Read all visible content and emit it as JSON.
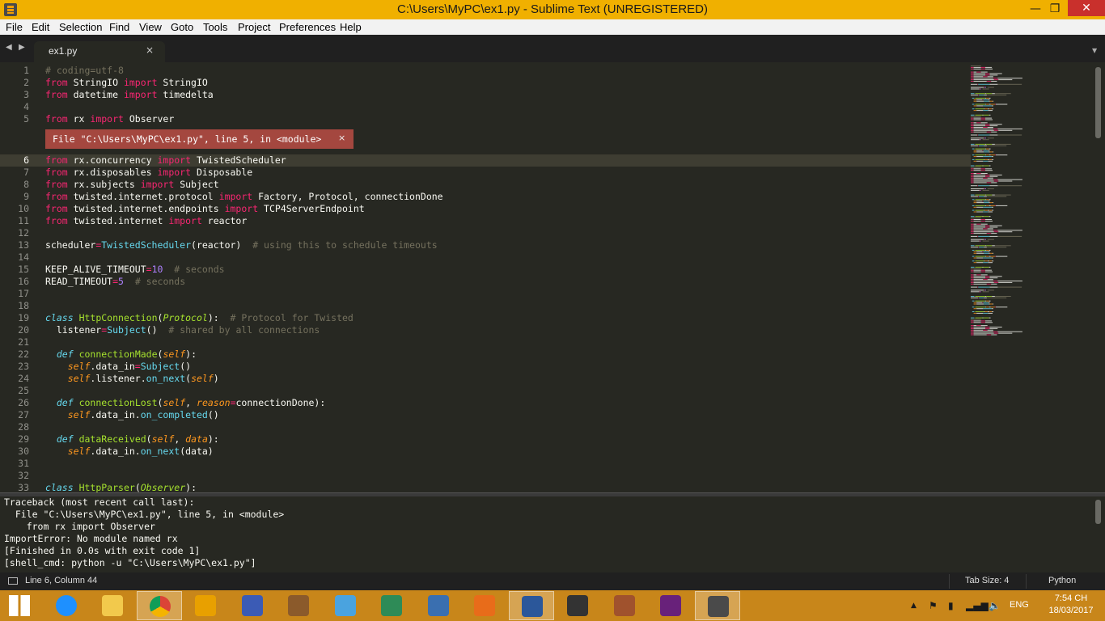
{
  "window": {
    "title": "C:\\Users\\MyPC\\ex1.py - Sublime Text (UNREGISTERED)",
    "minimize_glyph": "—",
    "maximize_glyph": "❐",
    "close_glyph": "✕"
  },
  "menu": [
    "File",
    "Edit",
    "Selection",
    "Find",
    "View",
    "Goto",
    "Tools",
    "Project",
    "Preferences",
    "Help"
  ],
  "tabs": {
    "nav_prev": "◀",
    "nav_next": "▶",
    "items": [
      {
        "label": "ex1.py",
        "close": "×"
      }
    ],
    "dropdown": "▼"
  },
  "colors": {
    "background": "#272822",
    "foreground": "#f8f8f2",
    "keyword": "#f92672",
    "function": "#66d9ef",
    "class_name": "#a6e22e",
    "comment": "#75715e",
    "number": "#ae81ff",
    "param": "#fd971f",
    "error_popup": "#a4473f",
    "title_bar": "#f0b000",
    "taskbar": "#c8861a"
  },
  "editor": {
    "current_line": 6,
    "error_popup": {
      "message": "File \"C:\\Users\\MyPC\\ex1.py\", line 5, in <module>",
      "close": "×",
      "after_line": 5
    },
    "lines": [
      {
        "n": 1,
        "segs": [
          [
            "# coding=utf-8",
            "c"
          ]
        ]
      },
      {
        "n": 2,
        "segs": [
          [
            "from",
            "k"
          ],
          [
            " StringIO ",
            ""
          ],
          [
            "import",
            "k"
          ],
          [
            " StringIO",
            ""
          ]
        ]
      },
      {
        "n": 3,
        "segs": [
          [
            "from",
            "k"
          ],
          [
            " datetime ",
            ""
          ],
          [
            "import",
            "k"
          ],
          [
            " timedelta",
            ""
          ]
        ]
      },
      {
        "n": 4,
        "segs": []
      },
      {
        "n": 5,
        "segs": [
          [
            "from",
            "k"
          ],
          [
            " rx ",
            ""
          ],
          [
            "import",
            "k"
          ],
          [
            " Observer",
            ""
          ]
        ]
      },
      {
        "n": 6,
        "segs": [
          [
            "from",
            "k"
          ],
          [
            " rx.concurrency ",
            ""
          ],
          [
            "import",
            "k"
          ],
          [
            " TwistedScheduler",
            ""
          ]
        ]
      },
      {
        "n": 7,
        "segs": [
          [
            "from",
            "k"
          ],
          [
            " rx.disposables ",
            ""
          ],
          [
            "import",
            "k"
          ],
          [
            " Disposable",
            ""
          ]
        ]
      },
      {
        "n": 8,
        "segs": [
          [
            "from",
            "k"
          ],
          [
            " rx.subjects ",
            ""
          ],
          [
            "import",
            "k"
          ],
          [
            " Subject",
            ""
          ]
        ]
      },
      {
        "n": 9,
        "segs": [
          [
            "from",
            "k"
          ],
          [
            " twisted.internet.protocol ",
            ""
          ],
          [
            "import",
            "k"
          ],
          [
            " Factory, Protocol, connectionDone",
            ""
          ]
        ]
      },
      {
        "n": 10,
        "segs": [
          [
            "from",
            "k"
          ],
          [
            " twisted.internet.endpoints ",
            ""
          ],
          [
            "import",
            "k"
          ],
          [
            " TCP4ServerEndpoint",
            ""
          ]
        ]
      },
      {
        "n": 11,
        "segs": [
          [
            "from",
            "k"
          ],
          [
            " twisted.internet ",
            ""
          ],
          [
            "import",
            "k"
          ],
          [
            " reactor",
            ""
          ]
        ]
      },
      {
        "n": 12,
        "segs": []
      },
      {
        "n": 13,
        "segs": [
          [
            "scheduler",
            ""
          ],
          [
            "=",
            "k"
          ],
          [
            "TwistedScheduler",
            "f"
          ],
          [
            "(reactor)  ",
            ""
          ],
          [
            "# using this to schedule timeouts",
            "c"
          ]
        ]
      },
      {
        "n": 14,
        "segs": []
      },
      {
        "n": 15,
        "segs": [
          [
            "KEEP_ALIVE_TIMEOUT",
            ""
          ],
          [
            "=",
            "k"
          ],
          [
            "10",
            "n"
          ],
          [
            "  ",
            ""
          ],
          [
            "# seconds",
            "c"
          ]
        ]
      },
      {
        "n": 16,
        "segs": [
          [
            "READ_TIMEOUT",
            ""
          ],
          [
            "=",
            "k"
          ],
          [
            "5",
            "n"
          ],
          [
            "  ",
            ""
          ],
          [
            "# seconds",
            "c"
          ]
        ]
      },
      {
        "n": 17,
        "segs": []
      },
      {
        "n": 18,
        "segs": []
      },
      {
        "n": 19,
        "segs": [
          [
            "class",
            "fi"
          ],
          [
            " ",
            ""
          ],
          [
            "HttpConnection",
            "g"
          ],
          [
            "(",
            ""
          ],
          [
            "Protocol",
            "gi"
          ],
          [
            "):  ",
            ""
          ],
          [
            "# Protocol for Twisted",
            "c"
          ]
        ]
      },
      {
        "n": 20,
        "segs": [
          [
            "  listener",
            ""
          ],
          [
            "=",
            "k"
          ],
          [
            "Subject",
            "f"
          ],
          [
            "()  ",
            ""
          ],
          [
            "# shared by all connections",
            "c"
          ]
        ]
      },
      {
        "n": 21,
        "segs": []
      },
      {
        "n": 22,
        "segs": [
          [
            "  ",
            ""
          ],
          [
            "def",
            "fi"
          ],
          [
            " ",
            ""
          ],
          [
            "connectionMade",
            "g"
          ],
          [
            "(",
            ""
          ],
          [
            "self",
            "p"
          ],
          [
            "):",
            ""
          ]
        ]
      },
      {
        "n": 23,
        "segs": [
          [
            "    ",
            ""
          ],
          [
            "self",
            "p"
          ],
          [
            ".data_in",
            ""
          ],
          [
            "=",
            "k"
          ],
          [
            "Subject",
            "f"
          ],
          [
            "()",
            ""
          ]
        ]
      },
      {
        "n": 24,
        "segs": [
          [
            "    ",
            ""
          ],
          [
            "self",
            "p"
          ],
          [
            ".listener.",
            ""
          ],
          [
            "on_next",
            "f"
          ],
          [
            "(",
            ""
          ],
          [
            "self",
            "p"
          ],
          [
            ")",
            ""
          ]
        ]
      },
      {
        "n": 25,
        "segs": []
      },
      {
        "n": 26,
        "segs": [
          [
            "  ",
            ""
          ],
          [
            "def",
            "fi"
          ],
          [
            " ",
            ""
          ],
          [
            "connectionLost",
            "g"
          ],
          [
            "(",
            ""
          ],
          [
            "self",
            "p"
          ],
          [
            ", ",
            ""
          ],
          [
            "reason",
            "p"
          ],
          [
            "=",
            "k"
          ],
          [
            "connectionDone):",
            ""
          ]
        ]
      },
      {
        "n": 27,
        "segs": [
          [
            "    ",
            ""
          ],
          [
            "self",
            "p"
          ],
          [
            ".data_in.",
            ""
          ],
          [
            "on_completed",
            "f"
          ],
          [
            "()",
            ""
          ]
        ]
      },
      {
        "n": 28,
        "segs": []
      },
      {
        "n": 29,
        "segs": [
          [
            "  ",
            ""
          ],
          [
            "def",
            "fi"
          ],
          [
            " ",
            ""
          ],
          [
            "dataReceived",
            "g"
          ],
          [
            "(",
            ""
          ],
          [
            "self",
            "p"
          ],
          [
            ", ",
            ""
          ],
          [
            "data",
            "p"
          ],
          [
            "):",
            ""
          ]
        ]
      },
      {
        "n": 30,
        "segs": [
          [
            "    ",
            ""
          ],
          [
            "self",
            "p"
          ],
          [
            ".data_in.",
            ""
          ],
          [
            "on_next",
            "f"
          ],
          [
            "(data)",
            ""
          ]
        ]
      },
      {
        "n": 31,
        "segs": []
      },
      {
        "n": 32,
        "segs": []
      },
      {
        "n": 33,
        "segs": [
          [
            "class",
            "fi"
          ],
          [
            " ",
            ""
          ],
          [
            "HttpParser",
            "g"
          ],
          [
            "(",
            ""
          ],
          [
            "Observer",
            "gi"
          ],
          [
            "):",
            ""
          ]
        ]
      }
    ]
  },
  "console": {
    "lines": [
      "Traceback (most recent call last):",
      "  File \"C:\\Users\\MyPC\\ex1.py\", line 5, in <module>",
      "    from rx import Observer",
      "ImportError: No module named rx",
      "[Finished in 0.0s with exit code 1]",
      "[shell_cmd: python -u \"C:\\Users\\MyPC\\ex1.py\"]"
    ]
  },
  "status": {
    "position": "Line 6, Column 44",
    "tab_size": "Tab Size: 4",
    "syntax": "Python"
  },
  "taskbar": {
    "apps": [
      {
        "name": "windows-start",
        "color": "#ffffff",
        "active": false
      },
      {
        "name": "internet-explorer",
        "color": "#1e90ff",
        "active": false
      },
      {
        "name": "file-explorer",
        "color": "#f2c94c",
        "active": false
      },
      {
        "name": "chrome",
        "color": "#db4437",
        "active": true
      },
      {
        "name": "sun-app",
        "color": "#e8a000",
        "active": false
      },
      {
        "name": "flag-app",
        "color": "#3b5bb5",
        "active": false
      },
      {
        "name": "book-app",
        "color": "#8b5a2b",
        "active": false
      },
      {
        "name": "notes-app",
        "color": "#4aa3df",
        "active": false
      },
      {
        "name": "globe-app",
        "color": "#2e8b57",
        "active": false
      },
      {
        "name": "v4-app",
        "color": "#3a6fb0",
        "active": false
      },
      {
        "name": "matlab",
        "color": "#e86c1a",
        "active": false
      },
      {
        "name": "word",
        "color": "#2b579a",
        "active": true
      },
      {
        "name": "a6-app",
        "color": "#333333",
        "active": false
      },
      {
        "name": "winrar",
        "color": "#a0522d",
        "active": false
      },
      {
        "name": "visual-studio",
        "color": "#68217a",
        "active": false
      },
      {
        "name": "sublime-text",
        "color": "#4a4a4a",
        "active": true
      }
    ],
    "tray_up": "▲",
    "language": "ENG",
    "time": "7:54 CH",
    "date": "18/03/2017"
  }
}
